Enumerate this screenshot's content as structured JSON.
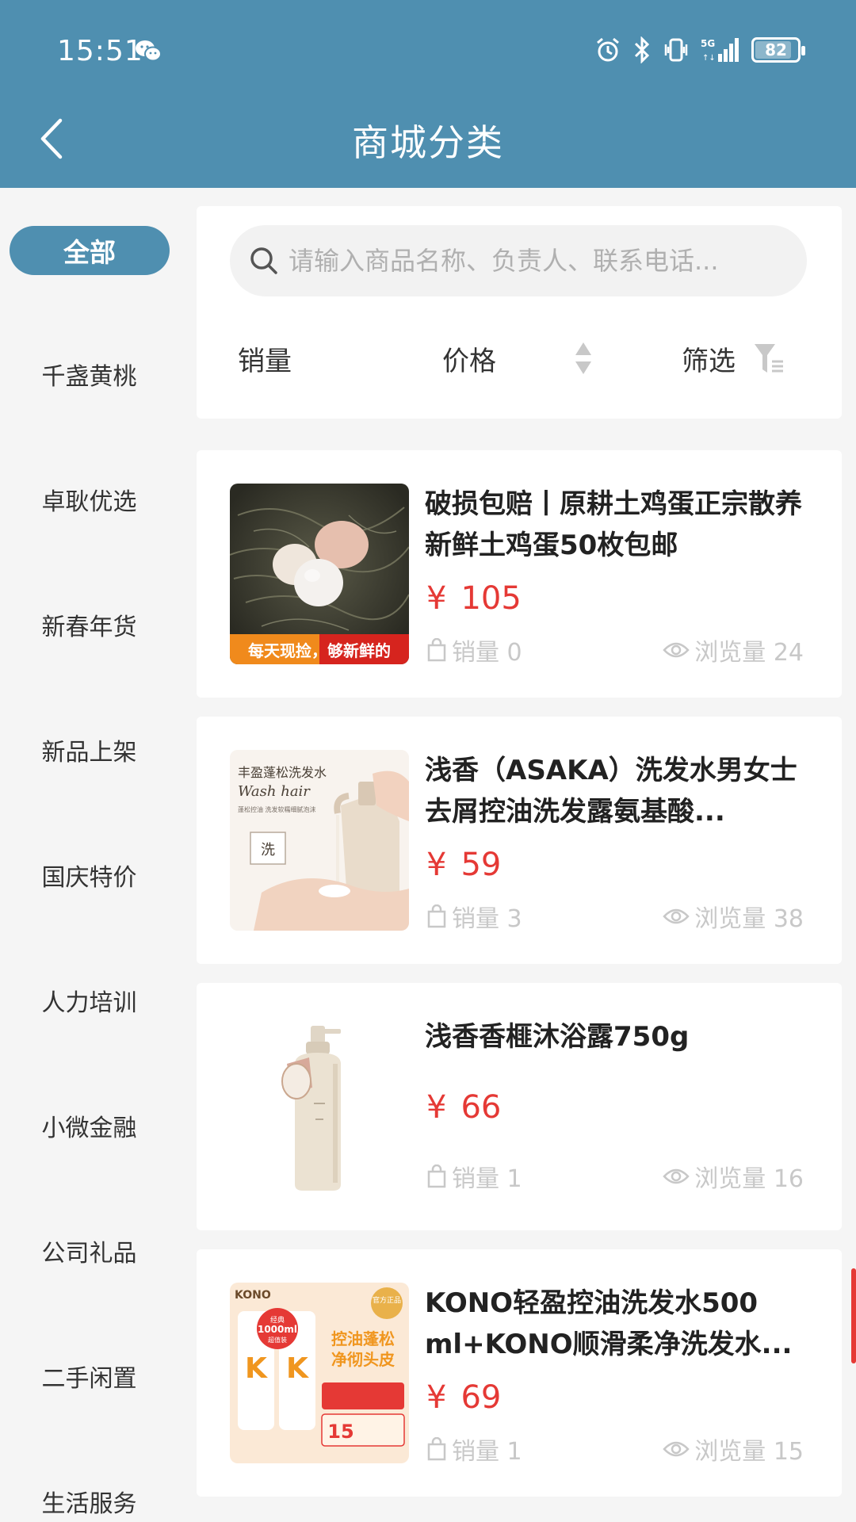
{
  "status_bar": {
    "time": "15:51",
    "battery": "82"
  },
  "header": {
    "title": "商城分类"
  },
  "sidebar": {
    "items": [
      {
        "label": "全部",
        "active": true
      },
      {
        "label": "千盏黄桃"
      },
      {
        "label": "卓耿优选"
      },
      {
        "label": "新春年货"
      },
      {
        "label": "新品上架"
      },
      {
        "label": "国庆特价"
      },
      {
        "label": "人力培训"
      },
      {
        "label": "小微金融"
      },
      {
        "label": "公司礼品"
      },
      {
        "label": "二手闲置"
      },
      {
        "label": "生活服务"
      }
    ]
  },
  "search": {
    "placeholder": "请输入商品名称、负责人、联系电话..."
  },
  "sort": {
    "sales": "销量",
    "price": "价格",
    "filter": "筛选"
  },
  "products": [
    {
      "title": "破损包赔丨原耕土鸡蛋正宗散养新鲜土鸡蛋50枚包邮",
      "price_symbol": "¥",
      "price": "105",
      "sales": "销量 0",
      "views": "浏览量 24",
      "image_banner": "每天现捡，够新鲜的"
    },
    {
      "title": "浅香（ASAKA）洗发水男女士去屑控油洗发露氨基酸...",
      "price_symbol": "¥",
      "price": "59",
      "sales": "销量 3",
      "views": "浏览量 38",
      "image_text": {
        "line1": "丰盈蓬松洗发水",
        "line2": "Wash hair",
        "line3": "蓬松控油 洗发软糯细腻泡沫",
        "tag": "洗"
      }
    },
    {
      "title": "浅香香榧沐浴露750g",
      "price_symbol": "¥",
      "price": "66",
      "sales": "销量 1",
      "views": "浏览量 16"
    },
    {
      "title": "KONO轻盈控油洗发水500 ml+KONO顺滑柔净洗发水...",
      "price_symbol": "¥",
      "price": "69",
      "sales": "销量 1",
      "views": "浏览量 15",
      "image_text": {
        "brand": "KONO",
        "badge": "官方正品",
        "volume": "1000ml",
        "volume_top": "经典",
        "volume_bottom": "超值装",
        "slogan1": "控油蓬松",
        "slogan2": "净彻头皮",
        "coupon": "15"
      }
    }
  ],
  "colors": {
    "primary": "#4f8fb0",
    "price": "#e53935",
    "meta": "#c8c8c8"
  }
}
